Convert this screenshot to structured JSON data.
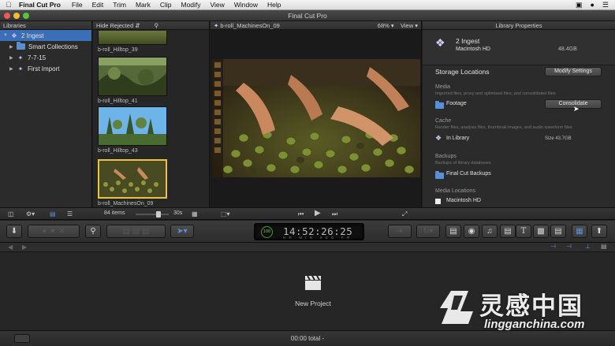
{
  "menubar": {
    "app": "Final Cut Pro",
    "items": [
      "File",
      "Edit",
      "Trim",
      "Mark",
      "Clip",
      "Modify",
      "View",
      "Window",
      "Help"
    ]
  },
  "window": {
    "title": "Final Cut Pro"
  },
  "libraries": {
    "header": "Libraries",
    "items": [
      {
        "label": "2 Ingest",
        "icon": "library-icon",
        "selected": true
      },
      {
        "label": "Smart Collections",
        "icon": "folder-icon"
      },
      {
        "label": "7-7-15",
        "icon": "event-icon"
      },
      {
        "label": "First Import",
        "icon": "event-icon"
      }
    ]
  },
  "browser": {
    "filter": "Hide Rejected",
    "clips": [
      {
        "label": "b-roll_Hilltop_39"
      },
      {
        "label": "b-roll_Hilltop_41"
      },
      {
        "label": "b-roll_Hilltop_43"
      },
      {
        "label": "b-roll_MachinesOn_09",
        "selected": true
      }
    ],
    "item_count": "84 items",
    "duration": "30s"
  },
  "viewer": {
    "clip_name": "b-roll_MachinesOn_09",
    "zoom": "68%",
    "view_menu": "View"
  },
  "inspector": {
    "header": "Library Properties",
    "library_name": "2 Ingest",
    "drive": "Macintosh HD",
    "size": "48.4GB",
    "storage_title": "Storage Locations",
    "modify_button": "Modify Settings",
    "media_title": "Media",
    "media_desc": "Imported files, proxy and optimised files, and consolidated files",
    "media_location": "Footage",
    "consolidate_button": "Consolidate",
    "cache_title": "Cache",
    "cache_desc": "Render files, analysis files, thumbnail images, and audio waveform files",
    "cache_location": "In Library",
    "cache_size": "Size 43.7GB",
    "backups_title": "Backups",
    "backups_desc": "Backups of library databases",
    "backups_location": "Final Cut Backups",
    "media_locations_title": "Media Locations",
    "media_locations_drive": "Macintosh HD"
  },
  "toolbar": {
    "timecode": "14:52:26:25",
    "timecode_units": "HR MIN SEC FR",
    "background_tasks": "100"
  },
  "timeline": {
    "placeholder": "New Project",
    "total": "00:00 total -"
  },
  "watermark": {
    "chinese": "灵感中国",
    "site": "lingganchina.com"
  },
  "colors": {
    "selection": "#3a6fb8",
    "accent_green": "#6fc86f",
    "clip_highlight": "#e9c24a"
  }
}
